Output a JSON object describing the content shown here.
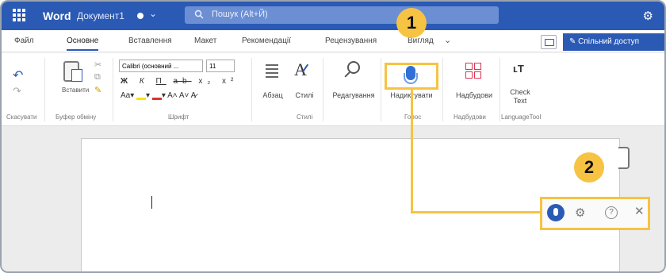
{
  "titlebar": {
    "app_name": "Word",
    "document_name": "Документ1",
    "search_placeholder": "Пошук (Alt+Й)",
    "accent_color": "#2b5ab5"
  },
  "tabs": [
    {
      "label": "Файл"
    },
    {
      "label": "Основне"
    },
    {
      "label": "Вставлення"
    },
    {
      "label": "Макет"
    },
    {
      "label": "Рекомендації"
    },
    {
      "label": "Рецензування"
    },
    {
      "label": "Вигляд"
    }
  ],
  "share_button": {
    "label": "Спільний доступ"
  },
  "ribbon": {
    "undo_group": "Скасувати",
    "clipboard": {
      "paste_label": "Вставити",
      "group": "Буфер обміну"
    },
    "font": {
      "name": "Calibri (основний ...",
      "size": "11",
      "group": "Шрифт"
    },
    "paragraph": {
      "label": "Абзац"
    },
    "styles": {
      "label": "Стилі",
      "group": "Стилі"
    },
    "editing": {
      "label": "Редагування"
    },
    "dictate": {
      "label": "Надиктувати",
      "group": "Голос"
    },
    "addins": {
      "label": "Надбудови",
      "group": "Надбудови"
    },
    "languagetool": {
      "label1": "Check",
      "label2": "Text",
      "group": "LanguageTool"
    }
  },
  "callouts": {
    "one": "1",
    "two": "2",
    "color": "#f6c343"
  },
  "icons": [
    "app-launcher-icon",
    "search-icon",
    "gear-icon",
    "undo-icon",
    "redo-icon",
    "paste-icon",
    "cut-icon",
    "copy-icon",
    "format-painter-icon",
    "paragraph-icon",
    "styles-icon",
    "search-editing-icon",
    "microphone-icon",
    "addins-icon",
    "languagetool-icon",
    "comment-icon",
    "settings-gear-icon",
    "help-icon",
    "close-icon"
  ]
}
